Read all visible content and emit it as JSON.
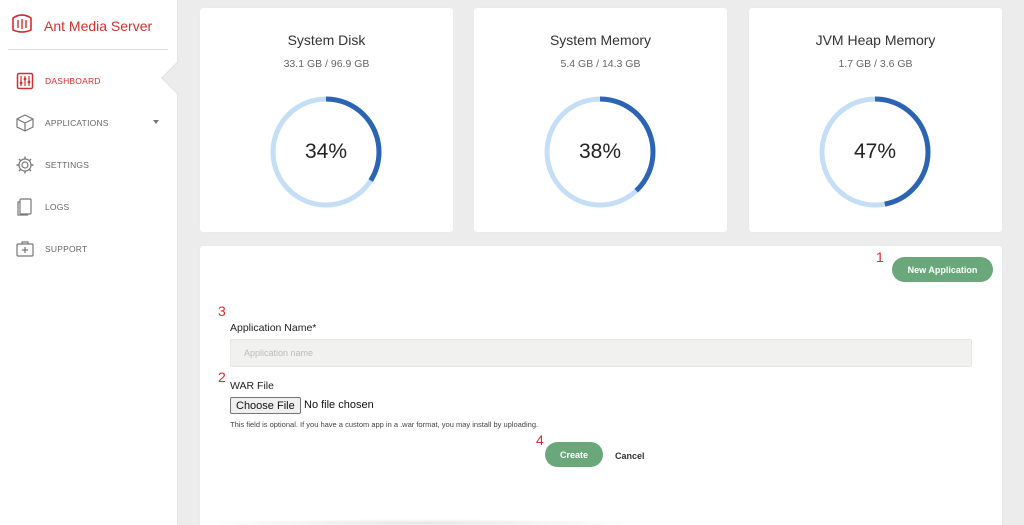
{
  "app": {
    "brand_name": "Ant Media Server",
    "brand_color": "#d0302f"
  },
  "sidebar": {
    "items": [
      {
        "label": "DASHBOARD",
        "icon": "dashboard-icon",
        "active": true
      },
      {
        "label": "APPLICATIONS",
        "icon": "box-icon",
        "has_dropdown": true
      },
      {
        "label": "SETTINGS",
        "icon": "gear-icon"
      },
      {
        "label": "LOGS",
        "icon": "logs-icon"
      },
      {
        "label": "SUPPORT",
        "icon": "support-icon"
      }
    ]
  },
  "stats": [
    {
      "title": "System Disk",
      "usage": "33.1 GB / 96.9 GB",
      "percent_label": "34%",
      "percent": 34
    },
    {
      "title": "System Memory",
      "usage": "5.4 GB / 14.3 GB",
      "percent_label": "38%",
      "percent": 38
    },
    {
      "title": "JVM Heap Memory",
      "usage": "1.7 GB / 3.6 GB",
      "percent_label": "47%",
      "percent": 47
    }
  ],
  "gauge_colors": {
    "track": "#c3def6",
    "fill": "#2c64b4"
  },
  "new_app_form": {
    "new_application_label": "New Application",
    "app_name_label": "Application Name*",
    "app_name_placeholder": "Application name",
    "war_file_label": "WAR File",
    "choose_file_label": "Choose File",
    "file_status": "No file chosen",
    "help_text": "This field is optional. If you have a custom app in a .war format, you may install by uploading.",
    "create_label": "Create",
    "cancel_label": "Cancel",
    "button_color": "#6aa77b"
  },
  "markers": [
    "1",
    "2",
    "3",
    "4"
  ]
}
